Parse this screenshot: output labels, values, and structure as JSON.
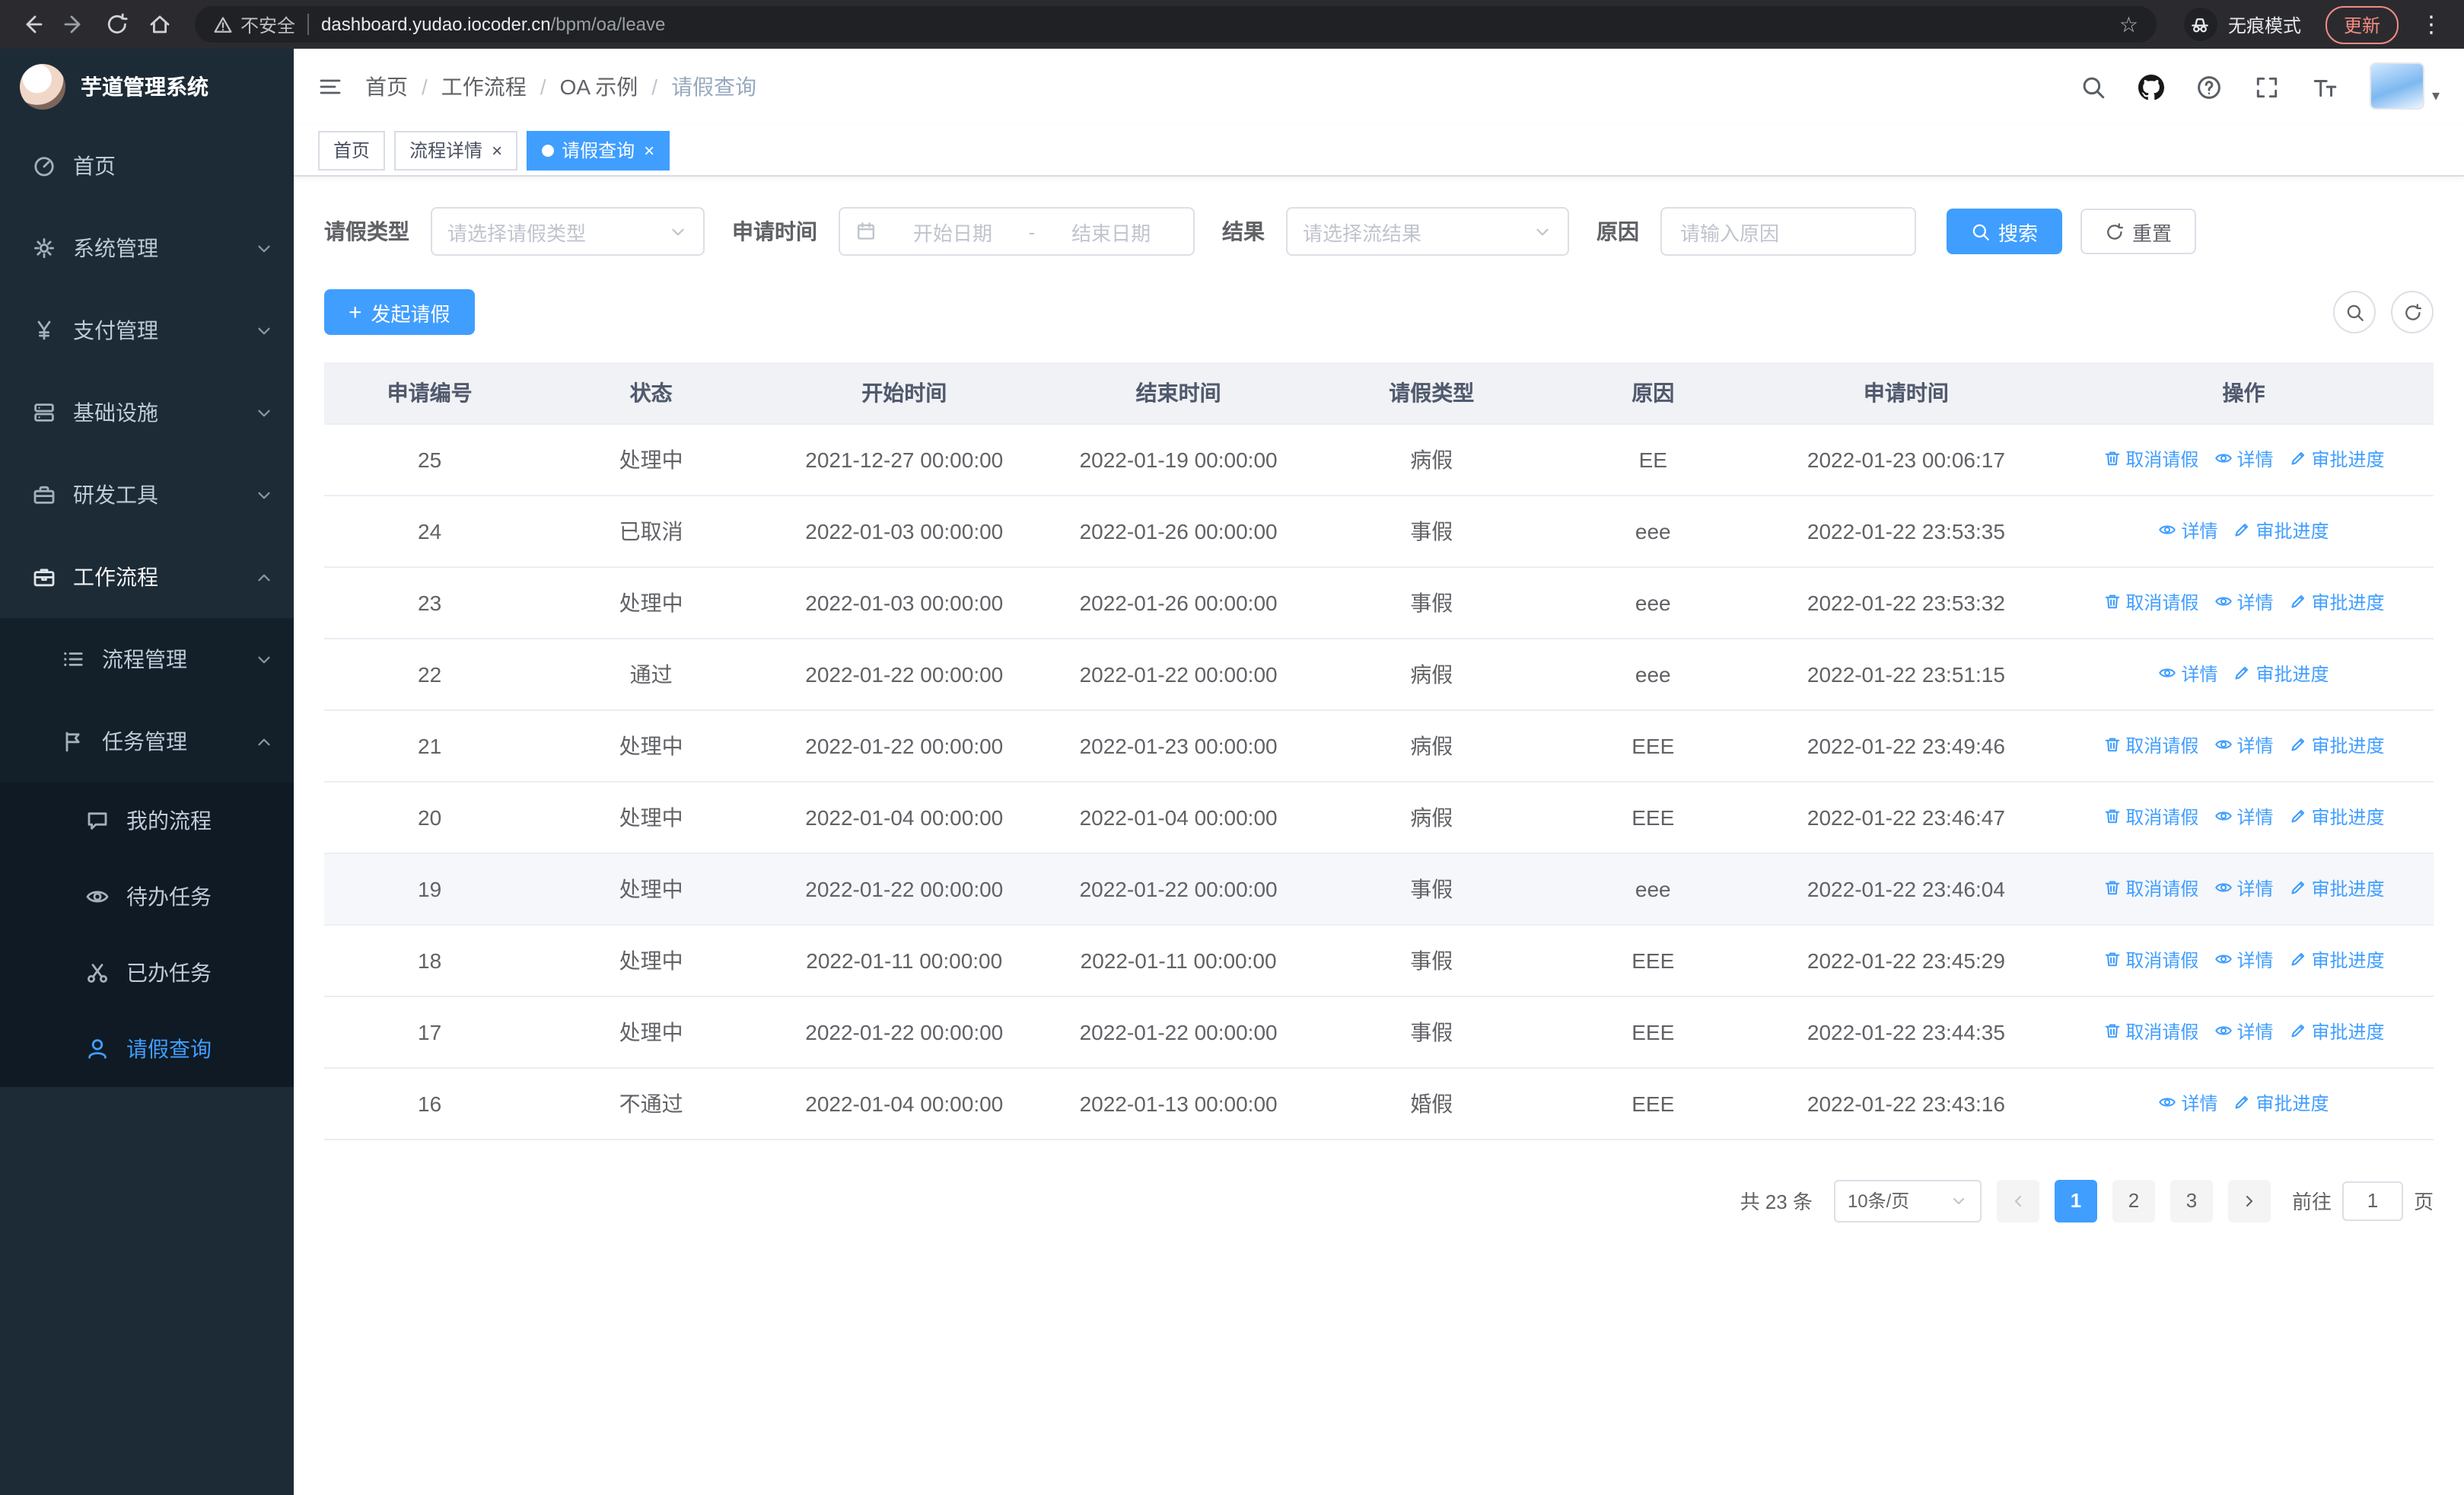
{
  "colors": {
    "accent": "#409EFF",
    "sidebar_bg": "#1D2B36",
    "sidebar_submenu_bg": "#131F29",
    "chrome_bg": "#2B2B2F",
    "update_chip": "#F28B82",
    "table_header_bg": "#F0F2F5"
  },
  "icons": {
    "star": "☆",
    "kebab": "⋮",
    "caret_down": "▾",
    "close": "×",
    "plus": "+"
  },
  "browser": {
    "security_warning": "不安全",
    "url_domain": "dashboard.yudao.iocoder.cn",
    "url_path": "/bpm/oa/leave",
    "incognito_label": "无痕模式",
    "update_button": "更新"
  },
  "sidebar": {
    "logo_title": "芋道管理系统",
    "items": {
      "home": "首页",
      "system": "系统管理",
      "payment": "支付管理",
      "infra": "基础设施",
      "devtools": "研发工具",
      "workflow": "工作流程",
      "process_mgmt": "流程管理",
      "task_mgmt": "任务管理",
      "my_process": "我的流程",
      "todo_tasks": "待办任务",
      "done_tasks": "已办任务",
      "leave_query": "请假查询"
    }
  },
  "header": {
    "breadcrumb": [
      "首页",
      "工作流程",
      "OA 示例",
      "请假查询"
    ]
  },
  "tabs": {
    "home": "首页",
    "process_detail": "流程详情",
    "leave_query": "请假查询"
  },
  "filters": {
    "leave_type_label": "请假类型",
    "leave_type_placeholder": "请选择请假类型",
    "apply_time_label": "申请时间",
    "start_date_placeholder": "开始日期",
    "date_separator": "-",
    "end_date_placeholder": "结束日期",
    "result_label": "结果",
    "result_placeholder": "请选择流结果",
    "reason_label": "原因",
    "reason_placeholder": "请输入原因",
    "search_button": "搜索",
    "reset_button": "重置"
  },
  "toolbar": {
    "create_button": "发起请假"
  },
  "table": {
    "columns": [
      "申请编号",
      "状态",
      "开始时间",
      "结束时间",
      "请假类型",
      "原因",
      "申请时间",
      "操作"
    ],
    "op_labels": {
      "cancel": "取消请假",
      "detail": "详情",
      "progress": "审批进度"
    },
    "rows": [
      {
        "id": "25",
        "status": "处理中",
        "start": "2021-12-27 00:00:00",
        "end": "2022-01-19 00:00:00",
        "type": "病假",
        "reason": "EE",
        "applied": "2022-01-23 00:06:17",
        "cancellable": true,
        "hover": false
      },
      {
        "id": "24",
        "status": "已取消",
        "start": "2022-01-03 00:00:00",
        "end": "2022-01-26 00:00:00",
        "type": "事假",
        "reason": "eee",
        "applied": "2022-01-22 23:53:35",
        "cancellable": false,
        "hover": false
      },
      {
        "id": "23",
        "status": "处理中",
        "start": "2022-01-03 00:00:00",
        "end": "2022-01-26 00:00:00",
        "type": "事假",
        "reason": "eee",
        "applied": "2022-01-22 23:53:32",
        "cancellable": true,
        "hover": false
      },
      {
        "id": "22",
        "status": "通过",
        "start": "2022-01-22 00:00:00",
        "end": "2022-01-22 00:00:00",
        "type": "病假",
        "reason": "eee",
        "applied": "2022-01-22 23:51:15",
        "cancellable": false,
        "hover": false
      },
      {
        "id": "21",
        "status": "处理中",
        "start": "2022-01-22 00:00:00",
        "end": "2022-01-23 00:00:00",
        "type": "病假",
        "reason": "EEE",
        "applied": "2022-01-22 23:49:46",
        "cancellable": true,
        "hover": false
      },
      {
        "id": "20",
        "status": "处理中",
        "start": "2022-01-04 00:00:00",
        "end": "2022-01-04 00:00:00",
        "type": "病假",
        "reason": "EEE",
        "applied": "2022-01-22 23:46:47",
        "cancellable": true,
        "hover": false
      },
      {
        "id": "19",
        "status": "处理中",
        "start": "2022-01-22 00:00:00",
        "end": "2022-01-22 00:00:00",
        "type": "事假",
        "reason": "eee",
        "applied": "2022-01-22 23:46:04",
        "cancellable": true,
        "hover": true
      },
      {
        "id": "18",
        "status": "处理中",
        "start": "2022-01-11 00:00:00",
        "end": "2022-01-11 00:00:00",
        "type": "事假",
        "reason": "EEE",
        "applied": "2022-01-22 23:45:29",
        "cancellable": true,
        "hover": false
      },
      {
        "id": "17",
        "status": "处理中",
        "start": "2022-01-22 00:00:00",
        "end": "2022-01-22 00:00:00",
        "type": "事假",
        "reason": "EEE",
        "applied": "2022-01-22 23:44:35",
        "cancellable": true,
        "hover": false
      },
      {
        "id": "16",
        "status": "不通过",
        "start": "2022-01-04 00:00:00",
        "end": "2022-01-13 00:00:00",
        "type": "婚假",
        "reason": "EEE",
        "applied": "2022-01-22 23:43:16",
        "cancellable": false,
        "hover": false
      }
    ]
  },
  "pagination": {
    "total_text": "共 23 条",
    "page_size": "10条/页",
    "pages": [
      "1",
      "2",
      "3"
    ],
    "active_page": "1",
    "goto_label": "前往",
    "goto_value": "1",
    "goto_suffix": "页"
  }
}
